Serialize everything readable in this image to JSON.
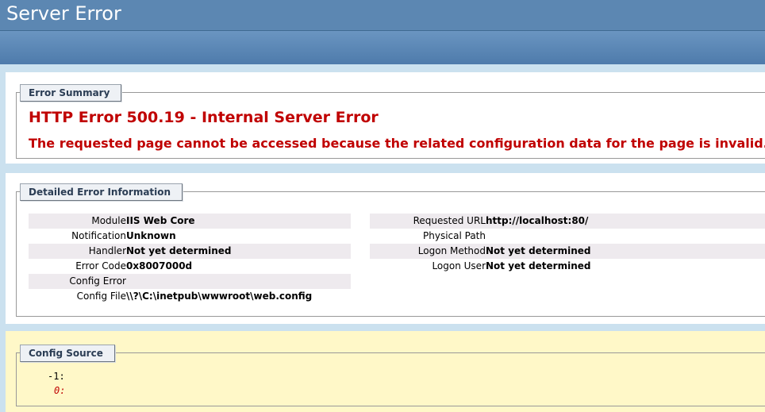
{
  "header": {
    "title": "Server Error"
  },
  "summary": {
    "legend": "Error Summary",
    "title": "HTTP Error 500.19 - Internal Server Error",
    "description": "The requested page cannot be accessed because the related configuration data for the page is invalid."
  },
  "details": {
    "legend": "Detailed Error Information",
    "left": [
      {
        "label": "Module",
        "value": "IIS Web Core"
      },
      {
        "label": "Notification",
        "value": "Unknown"
      },
      {
        "label": "Handler",
        "value": "Not yet determined"
      },
      {
        "label": "Error Code",
        "value": "0x8007000d"
      },
      {
        "label": "Config Error",
        "value": ""
      },
      {
        "label": "Config File",
        "value": "\\\\?\\C:\\inetpub\\wwwroot\\web.config"
      }
    ],
    "right": [
      {
        "label": "Requested URL",
        "value": "http://localhost:80/"
      },
      {
        "label": "Physical Path",
        "value": ""
      },
      {
        "label": "Logon Method",
        "value": "Not yet determined"
      },
      {
        "label": "Logon User",
        "value": "Not yet determined"
      }
    ]
  },
  "config_source": {
    "legend": "Config Source",
    "lines": [
      {
        "number": "-1:",
        "text": ""
      },
      {
        "number": "0:",
        "text": ""
      }
    ]
  },
  "colors": {
    "header_bg": "#5c87b2",
    "error_red": "#c00000",
    "line_highlight": "#c00000"
  }
}
